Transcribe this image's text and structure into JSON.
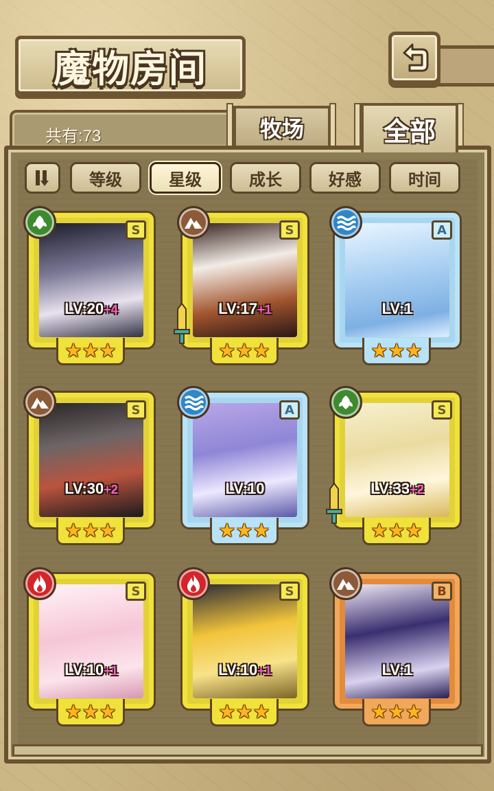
{
  "title": "魔物房间",
  "count_label": "共有:73",
  "tabs": [
    {
      "label": "牧场",
      "active": false
    },
    {
      "label": "全部",
      "active": true
    }
  ],
  "sort_buttons": [
    {
      "label": "等级",
      "active": false
    },
    {
      "label": "星级",
      "active": true
    },
    {
      "label": "成长",
      "active": false
    },
    {
      "label": "好感",
      "active": false
    },
    {
      "label": "时间",
      "active": false
    }
  ],
  "icons": {
    "back": "back-arrow-icon",
    "sort_toggle": "sort-order-icon",
    "element_grass": "leaf-icon",
    "element_earth": "mountain-icon",
    "element_water": "wave-icon",
    "element_fire": "flame-icon",
    "weapon": "sword-icon"
  },
  "colors": {
    "frame_gold": "#f1e23b",
    "frame_blue": "#b8e3f7",
    "frame_orange": "#f1a85a",
    "bonus_pink": "#ff5ec8",
    "star": "#ffb51e"
  },
  "monsters": [
    {
      "element": "grass",
      "rank": "S",
      "frame": "gold",
      "level": "LV:20",
      "bonus": "+4",
      "stars": 3,
      "weapon": false
    },
    {
      "element": "earth",
      "rank": "S",
      "frame": "gold",
      "level": "LV:17",
      "bonus": "+1",
      "stars": 3,
      "weapon": true
    },
    {
      "element": "water",
      "rank": "A",
      "frame": "blue",
      "level": "LV:1",
      "bonus": "",
      "stars": 3,
      "weapon": false
    },
    {
      "element": "earth",
      "rank": "S",
      "frame": "gold",
      "level": "LV:30",
      "bonus": "+2",
      "stars": 3,
      "weapon": false
    },
    {
      "element": "water",
      "rank": "A",
      "frame": "blue",
      "level": "LV:10",
      "bonus": "",
      "stars": 3,
      "weapon": false
    },
    {
      "element": "grass",
      "rank": "S",
      "frame": "gold",
      "level": "LV:33",
      "bonus": "+2",
      "stars": 3,
      "weapon": true
    },
    {
      "element": "fire",
      "rank": "S",
      "frame": "gold",
      "level": "LV:10",
      "bonus": "+1",
      "stars": 3,
      "weapon": false
    },
    {
      "element": "fire",
      "rank": "S",
      "frame": "gold",
      "level": "LV:10",
      "bonus": "+1",
      "stars": 3,
      "weapon": false
    },
    {
      "element": "earth",
      "rank": "B",
      "frame": "orange",
      "level": "LV:1",
      "bonus": "",
      "stars": 3,
      "weapon": false
    }
  ]
}
